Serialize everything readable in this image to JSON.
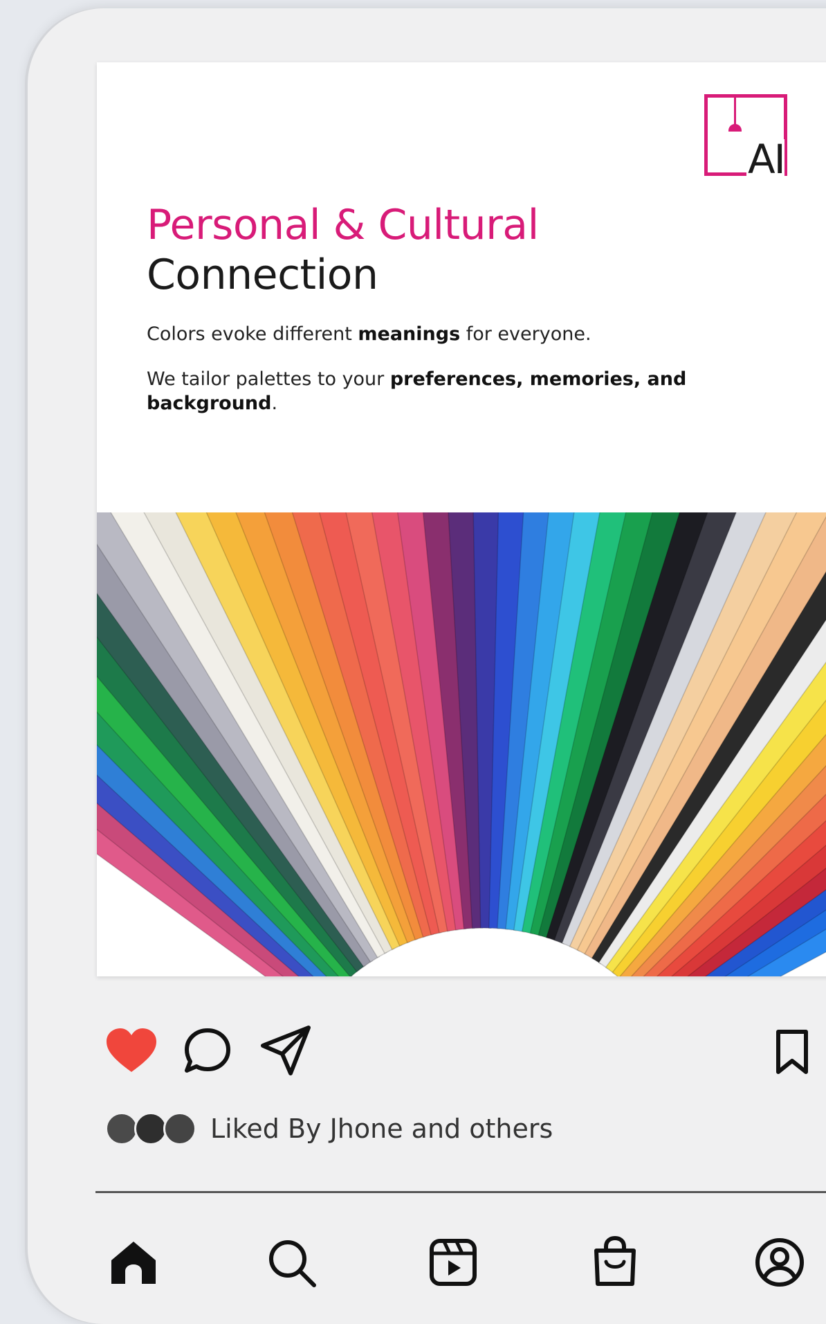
{
  "post": {
    "logo_text": "AI",
    "title_line1": "Personal & Cultural",
    "title_line2": "Connection",
    "p1_part1": "Colors evoke different ",
    "p1_bold": "meanings",
    "p1_part2": " for everyone.",
    "p2_part1": "We tailor palettes to your ",
    "p2_bold": "preferences, memories, and background",
    "p2_part2": ".",
    "image_icon": "color-swatch-fan-image"
  },
  "actions": {
    "liked": true,
    "like_color": "#f0463c",
    "like_icon": "heart-icon",
    "comment_icon": "comment-icon",
    "share_icon": "send-icon",
    "save_icon": "bookmark-icon"
  },
  "likes": {
    "text": "Liked By Jhone and others",
    "avatar_colors": [
      "#4a4a4a",
      "#2e2e2e",
      "#444444"
    ]
  },
  "nav": {
    "items": [
      {
        "icon": "home-icon",
        "active": true
      },
      {
        "icon": "search-icon",
        "active": false
      },
      {
        "icon": "reels-icon",
        "active": false
      },
      {
        "icon": "shop-icon",
        "active": false
      },
      {
        "icon": "profile-icon",
        "active": false
      }
    ]
  },
  "colors": {
    "accent": "#d81b78",
    "background": "#f0f0f1"
  }
}
